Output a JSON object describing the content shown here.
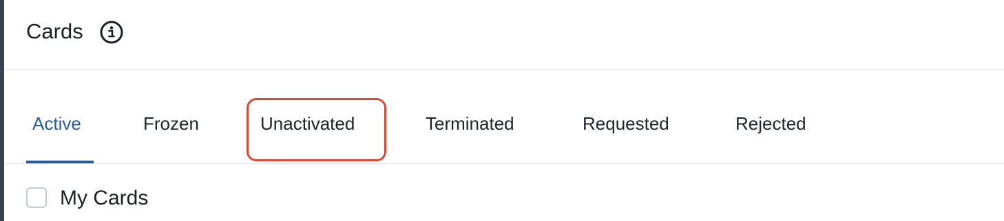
{
  "header": {
    "title": "Cards",
    "info_icon": "info-icon"
  },
  "tabs": [
    {
      "label": "Active",
      "active": true
    },
    {
      "label": "Frozen",
      "active": false
    },
    {
      "label": "Unactivated",
      "active": false,
      "highlighted": true
    },
    {
      "label": "Terminated",
      "active": false
    },
    {
      "label": "Requested",
      "active": false
    },
    {
      "label": "Rejected",
      "active": false
    }
  ],
  "filters": {
    "my_cards_label": "My Cards",
    "my_cards_checked": false
  },
  "colors": {
    "accent": "#2a5b99",
    "highlight": "#d94a38",
    "text": "#1c1f26",
    "divider": "#e3e5ea"
  }
}
